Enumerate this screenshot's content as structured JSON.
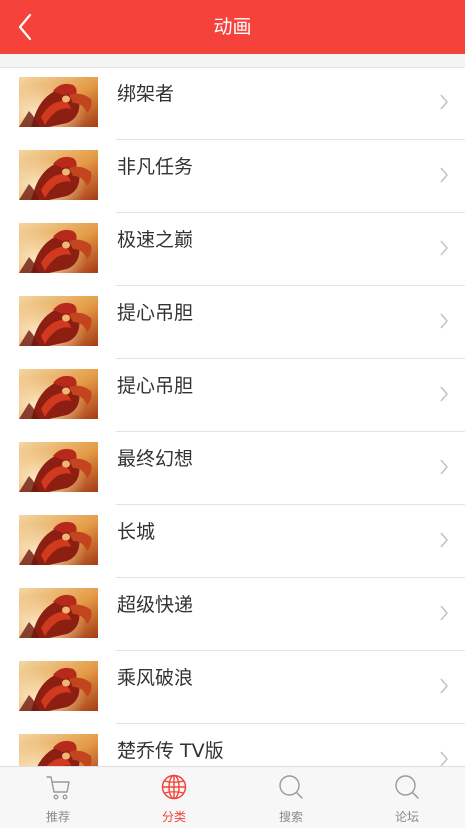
{
  "header": {
    "title": "动画"
  },
  "colors": {
    "accent": "#f5423a",
    "tab_inactive": "#8a8a8a"
  },
  "list": {
    "items": [
      {
        "title": "绑架者"
      },
      {
        "title": "非凡任务"
      },
      {
        "title": "极速之巅"
      },
      {
        "title": "提心吊胆"
      },
      {
        "title": "提心吊胆"
      },
      {
        "title": "最终幻想"
      },
      {
        "title": "长城"
      },
      {
        "title": "超级快递"
      },
      {
        "title": "乘风破浪"
      },
      {
        "title": "楚乔传 TV版"
      }
    ]
  },
  "tabbar": {
    "tabs": [
      {
        "label": "推荐",
        "icon": "cart-icon",
        "active": false
      },
      {
        "label": "分类",
        "icon": "globe-icon",
        "active": true
      },
      {
        "label": "搜索",
        "icon": "search-icon",
        "active": false
      },
      {
        "label": "论坛",
        "icon": "search-icon",
        "active": false
      }
    ]
  }
}
